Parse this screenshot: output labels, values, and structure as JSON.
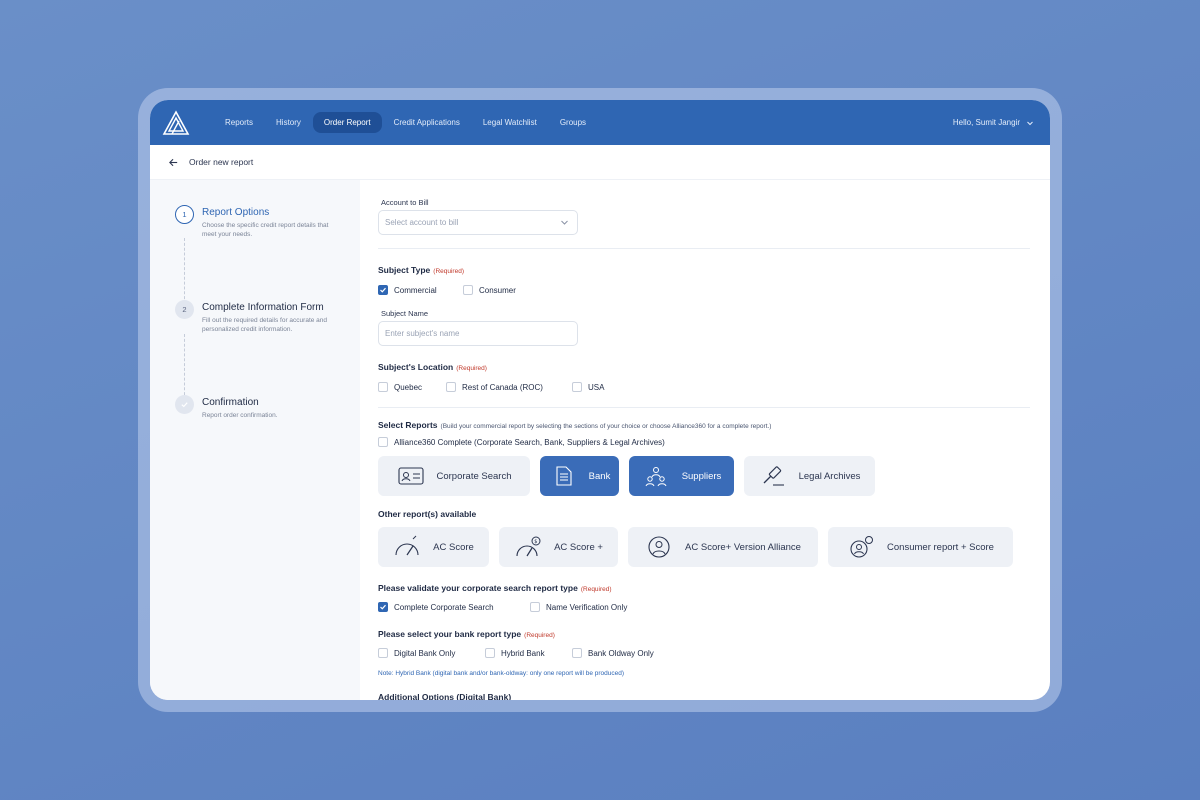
{
  "nav": {
    "items": [
      "Reports",
      "History",
      "Order Report",
      "Credit Applications",
      "Legal Watchlist",
      "Groups"
    ],
    "active": "Order Report",
    "user_greeting": "Hello, Sumit Jangir"
  },
  "breadcrumb": {
    "title": "Order new report"
  },
  "steps": [
    {
      "number": "1",
      "title": "Report Options",
      "desc": "Choose the specific credit report details that meet your needs."
    },
    {
      "number": "2",
      "title": "Complete Information Form",
      "desc": "Fill out the required details for accurate and personalized credit information."
    },
    {
      "number": "",
      "title": "Confirmation",
      "desc": "Report order confirmation."
    }
  ],
  "form": {
    "account_label": "Account to Bill",
    "account_placeholder": "Select account to bill",
    "subject_type_label": "Subject Type",
    "required": "(Required)",
    "commercial": "Commercial",
    "consumer": "Consumer",
    "subject_name_label": "Subject Name",
    "subject_name_placeholder": "Enter subject's name",
    "location_label": "Subject's Location",
    "quebec": "Quebec",
    "roc": "Rest of Canada (ROC)",
    "usa": "USA",
    "select_reports_label": "Select Reports",
    "select_reports_hint": "(Build your commercial report by selecting the sections of your choice or choose Alliance360 for a complete report.)",
    "alliance_label": "Alliance360 Complete (Corporate Search, Bank, Suppliers & Legal Archives)",
    "report_cards": [
      "Corporate Search",
      "Bank",
      "Suppliers",
      "Legal Archives"
    ],
    "other_reports_label": "Other report(s) available",
    "other_cards": [
      "AC Score",
      "AC Score +",
      "AC Score+ Version Alliance",
      "Consumer report + Score"
    ],
    "validate_label": "Please validate your corporate search report type",
    "complete_corp": "Complete Corporate Search",
    "name_verif": "Name Verification Only",
    "bank_label": "Please select your bank report type",
    "digital_bank": "Digital Bank Only",
    "hybrid_bank": "Hybrid Bank",
    "oldway_bank": "Bank Oldway Only",
    "bank_note": "Note: Hybrid Bank (digital bank and/or bank-oldway: only one report will be produced)",
    "additional": "Additional Options (Digital Bank)"
  },
  "colors": {
    "accent": "#2f66b3",
    "required": "#c0392b",
    "background": "#6a8fc8"
  }
}
